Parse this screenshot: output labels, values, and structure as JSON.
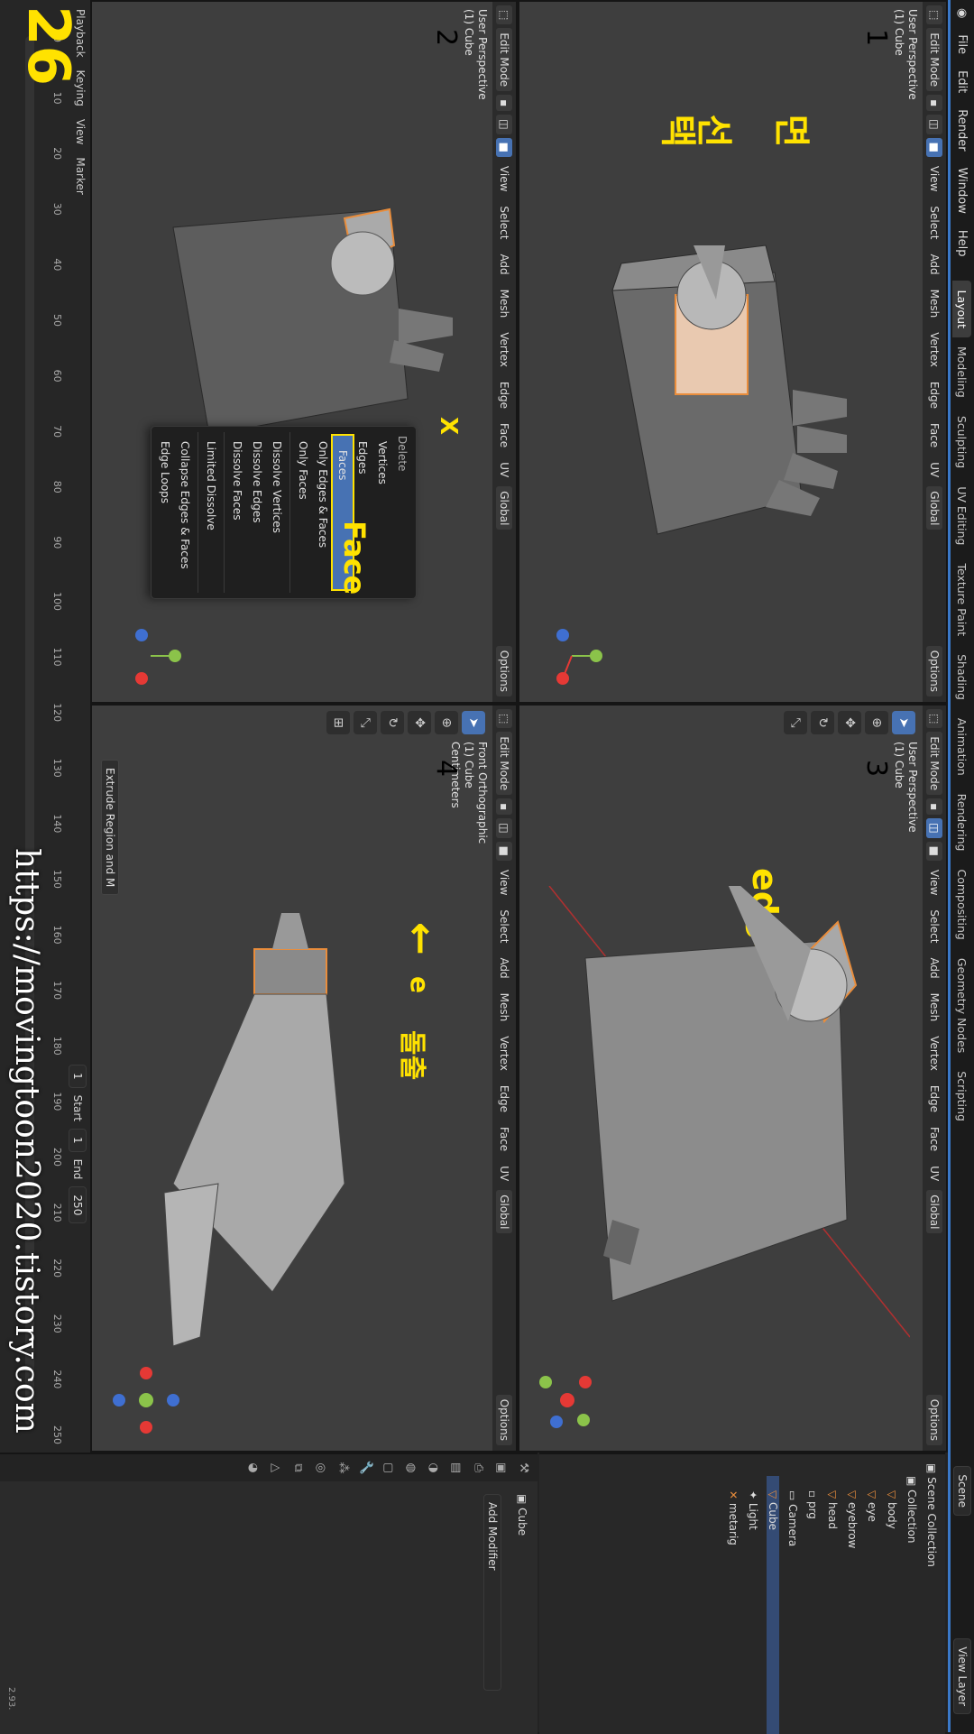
{
  "menubar": {
    "items": [
      "File",
      "Edit",
      "Render",
      "Window",
      "Help"
    ],
    "workspaces": [
      "Layout",
      "Modeling",
      "Sculpting",
      "UV Editing",
      "Texture Paint",
      "Shading",
      "Animation",
      "Rendering",
      "Compositing",
      "Geometry Nodes",
      "Scripting"
    ],
    "scene_label": "Scene",
    "view_layer_label": "View Layer"
  },
  "viewport_header": {
    "mode": "Edit Mode",
    "menus": [
      "View",
      "Select",
      "Add",
      "Mesh",
      "Vertex",
      "Edge",
      "Face",
      "UV"
    ],
    "transform": "Global",
    "options": "Options"
  },
  "viewports": [
    {
      "number": "1",
      "perspective": "User Perspective",
      "object": "(1) Cube",
      "caption": "면 선택"
    },
    {
      "number": "2",
      "perspective": "User Perspective",
      "object": "(1) Cube",
      "key_hint": "X",
      "caption": "Face"
    },
    {
      "number": "3",
      "perspective": "User Perspective",
      "object": "(1) Cube",
      "caption": "edge 선택"
    },
    {
      "number": "4",
      "perspective": "Front Orthographic",
      "object": "(1) Cube",
      "units": "Centimeters",
      "key_hint": "e",
      "caption": "돌출",
      "operator_panel": "Extrude Region and M"
    }
  ],
  "delete_menu": {
    "title": "Delete",
    "items": [
      "Vertices",
      "Edges",
      "Faces",
      "Only Edges & Faces",
      "Only Faces",
      "Dissolve Vertices",
      "Dissolve Edges",
      "Dissolve Faces",
      "Limited Dissolve",
      "Collapse Edges & Faces",
      "Edge Loops"
    ],
    "highlighted": "Faces"
  },
  "timeline": {
    "menus": [
      "Playback",
      "Keying",
      "View",
      "Marker"
    ],
    "current_frame": "1",
    "start_label": "Start",
    "start": "1",
    "end_label": "End",
    "end": "250",
    "ticks": [
      "0",
      "10",
      "20",
      "30",
      "40",
      "50",
      "60",
      "70",
      "80",
      "90",
      "100",
      "110",
      "120",
      "130",
      "140",
      "150",
      "160",
      "170",
      "180",
      "190",
      "200",
      "210",
      "220",
      "230",
      "240",
      "250"
    ]
  },
  "outliner": {
    "root": "Scene Collection",
    "collection": "Collection",
    "items": [
      "body",
      "eye",
      "eyebrow",
      "head",
      "prg",
      "Camera",
      "Cube",
      "Light",
      "metarig"
    ],
    "selected": "Cube"
  },
  "properties": {
    "object": "Cube",
    "add_modifier": "Add Modifier"
  },
  "overlay": {
    "frame_number": "26",
    "url": "https://movingtoon2020.tistory.com"
  },
  "status": {
    "version": "2.93."
  },
  "colors": {
    "accent": "#4772b3",
    "caption": "#ffe200",
    "selection": "#e98d3c"
  }
}
